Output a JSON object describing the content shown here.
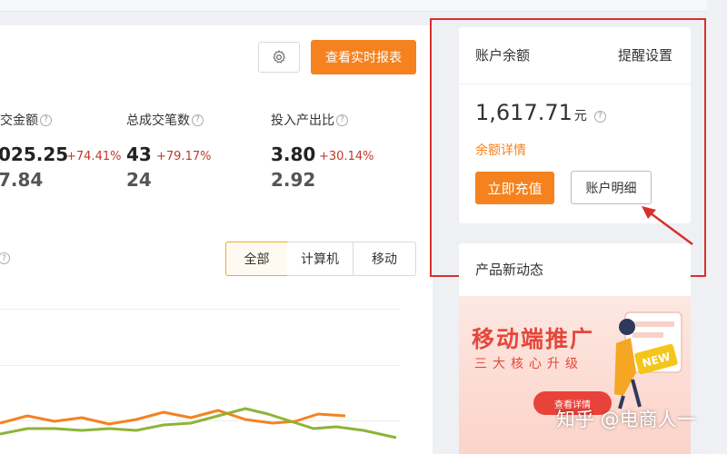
{
  "header": {
    "report_button": "查看实时报表"
  },
  "metrics": [
    {
      "label": "成交金额",
      "value": "025.25",
      "change": "+74.41%",
      "prev": "7.84"
    },
    {
      "label": "总成交笔数",
      "value": "43",
      "change": "+79.17%",
      "prev": "24"
    },
    {
      "label": "投入产出比",
      "value": "3.80",
      "change": "+30.14%",
      "prev": "2.92"
    }
  ],
  "help_glyph": "?",
  "device_tabs": [
    "全部",
    "计算机",
    "移动"
  ],
  "device_selected": "全部",
  "account": {
    "title": "账户余额",
    "remind": "提醒设置",
    "amount": "1,617.71",
    "unit": "元",
    "detail_link": "余额详情",
    "recharge_button": "立即充值",
    "ledger_button": "账户明细"
  },
  "news": {
    "title": "产品新动态",
    "banner_headline": "移动端推广",
    "banner_sub": "三大核心升级",
    "banner_button": "查看详情",
    "badge": "NEW"
  },
  "watermark": "知乎 @电商人一",
  "colors": {
    "accent": "#f5821f",
    "highlight_box": "#d9302c",
    "line_orange": "#f5821f",
    "line_green": "#8fb339",
    "change_red": "#c0392b"
  },
  "icons": {
    "settings": "gear-icon",
    "help": "help-circle-icon",
    "annotation": "red-arrow-icon"
  }
}
